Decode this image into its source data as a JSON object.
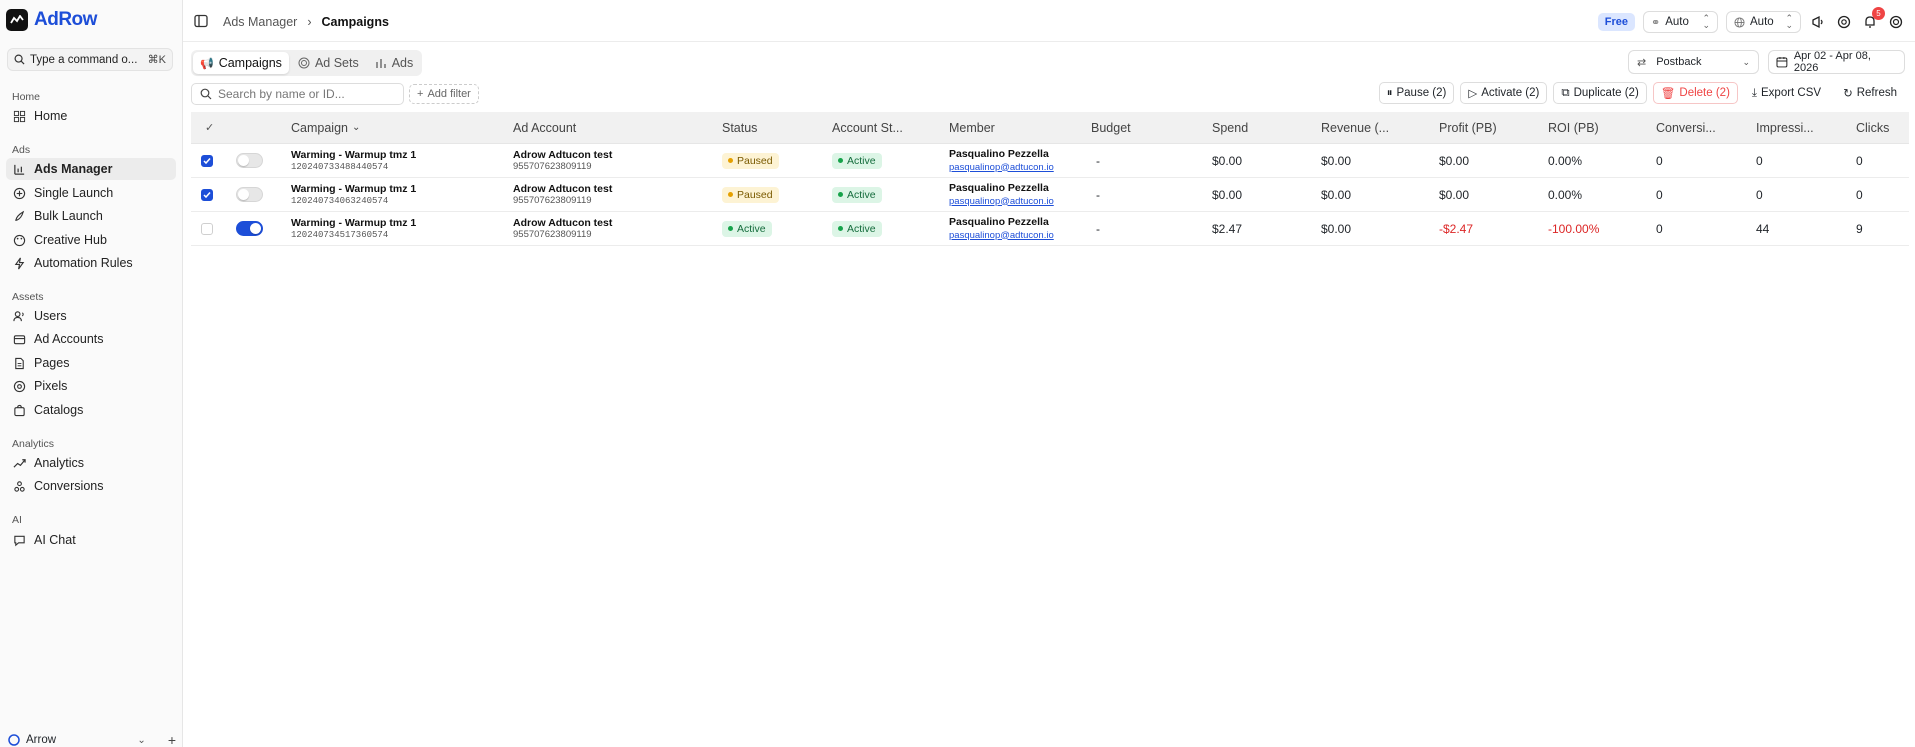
{
  "brand": {
    "name": "AdRow"
  },
  "command": {
    "placeholder": "Type a command o...",
    "shortcut": "⌘K"
  },
  "sidebar": {
    "sections": [
      {
        "title": "Home",
        "items": [
          {
            "label": "Home",
            "icon": "home-icon"
          }
        ]
      },
      {
        "title": "Ads",
        "items": [
          {
            "label": "Ads Manager",
            "icon": "bar-chart-icon",
            "active": true
          },
          {
            "label": "Single Launch",
            "icon": "plus-circle-icon"
          },
          {
            "label": "Bulk Launch",
            "icon": "rocket-icon"
          },
          {
            "label": "Creative Hub",
            "icon": "palette-icon"
          },
          {
            "label": "Automation Rules",
            "icon": "lightning-icon"
          }
        ]
      },
      {
        "title": "Assets",
        "items": [
          {
            "label": "Users",
            "icon": "users-icon"
          },
          {
            "label": "Ad Accounts",
            "icon": "wallet-icon"
          },
          {
            "label": "Pages",
            "icon": "file-icon"
          },
          {
            "label": "Pixels",
            "icon": "target-icon"
          },
          {
            "label": "Catalogs",
            "icon": "bag-icon"
          }
        ]
      },
      {
        "title": "Analytics",
        "items": [
          {
            "label": "Analytics",
            "icon": "trend-icon"
          },
          {
            "label": "Conversions",
            "icon": "webhook-icon"
          }
        ]
      },
      {
        "title": "AI",
        "items": [
          {
            "label": "AI Chat",
            "icon": "chat-icon"
          }
        ]
      }
    ],
    "workspace": "Arrow"
  },
  "topbar": {
    "breadcrumb": [
      "Ads Manager",
      "Campaigns"
    ],
    "plan": "Free",
    "select1": "Auto",
    "select2": "Auto",
    "notifications": "5"
  },
  "tabs": [
    "Campaigns",
    "Ad Sets",
    "Ads"
  ],
  "postback": "Postback",
  "date_range": "Apr 02 - Apr 08, 2026",
  "search": {
    "placeholder": "Search by name or ID..."
  },
  "add_filter": "Add filter",
  "actions": {
    "pause": "Pause (2)",
    "activate": "Activate (2)",
    "duplicate": "Duplicate (2)",
    "delete": "Delete (2)",
    "export": "Export CSV",
    "refresh": "Refresh"
  },
  "table": {
    "columns": [
      "Campaign",
      "Ad Account",
      "Status",
      "Account St...",
      "Member",
      "Budget",
      "Spend",
      "Revenue (...",
      "Profit (PB)",
      "ROI (PB)",
      "Conversi...",
      "Impressi...",
      "Clicks"
    ],
    "rows": [
      {
        "checked": true,
        "on": false,
        "name": "Warming - Warmup tmz 1",
        "id": "120240733488440574",
        "account": "Adrow Adtucon test",
        "account_id": "955707623809119",
        "status": "Paused",
        "account_status": "Active",
        "member": "Pasqualino Pezzella",
        "email": "pasqualinop@adtucon.io",
        "budget": "-",
        "spend": "$0.00",
        "revenue": "$0.00",
        "profit": "$0.00",
        "roi": "0.00%",
        "conversions": "0",
        "impressions": "0",
        "clicks": "0",
        "negative": false
      },
      {
        "checked": true,
        "on": false,
        "name": "Warming - Warmup tmz 1",
        "id": "120240734063240574",
        "account": "Adrow Adtucon test",
        "account_id": "955707623809119",
        "status": "Paused",
        "account_status": "Active",
        "member": "Pasqualino Pezzella",
        "email": "pasqualinop@adtucon.io",
        "budget": "-",
        "spend": "$0.00",
        "revenue": "$0.00",
        "profit": "$0.00",
        "roi": "0.00%",
        "conversions": "0",
        "impressions": "0",
        "clicks": "0",
        "negative": false
      },
      {
        "checked": false,
        "on": true,
        "name": "Warming - Warmup tmz 1",
        "id": "120240734517360574",
        "account": "Adrow Adtucon test",
        "account_id": "955707623809119",
        "status": "Active",
        "account_status": "Active",
        "member": "Pasqualino Pezzella",
        "email": "pasqualinop@adtucon.io",
        "budget": "-",
        "spend": "$2.47",
        "revenue": "$0.00",
        "profit": "-$2.47",
        "roi": "-100.00%",
        "conversions": "0",
        "impressions": "44",
        "clicks": "9",
        "negative": true
      }
    ]
  },
  "colors": {
    "accent": "#1d4ed8",
    "danger": "#dc2626",
    "paused": "#e5a000",
    "active": "#16a34a"
  }
}
